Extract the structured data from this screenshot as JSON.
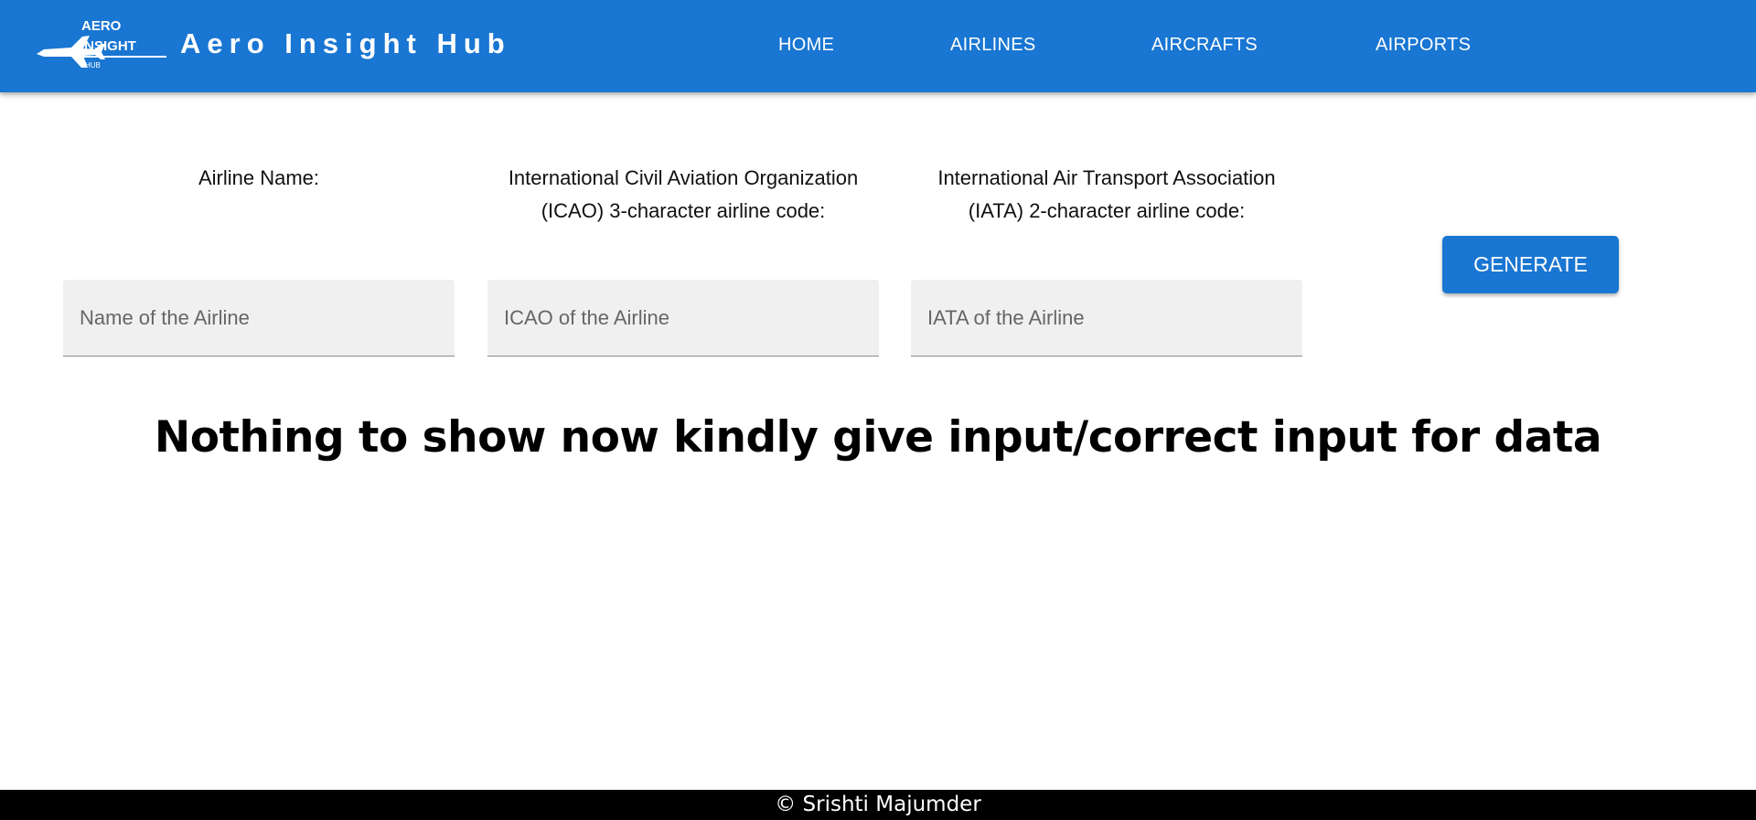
{
  "header": {
    "logo": {
      "word1": "AERO",
      "word2": "INSIGHT",
      "word3": "HUB"
    },
    "title": "Aero Insight Hub",
    "nav": [
      {
        "label": "HOME"
      },
      {
        "label": "AIRLINES"
      },
      {
        "label": "AIRCRAFTS"
      },
      {
        "label": "AIRPORTS"
      }
    ]
  },
  "form": {
    "name": {
      "label": "Airline Name:",
      "placeholder": "Name of the Airline",
      "value": ""
    },
    "icao": {
      "label": "International Civil Aviation Organization (ICAO) 3-character airline code:",
      "placeholder": "ICAO of the Airline",
      "value": ""
    },
    "iata": {
      "label": "International Air Transport Association (IATA) 2-character airline code:",
      "placeholder": "IATA of the Airline",
      "value": ""
    },
    "generate_label": "GENERATE"
  },
  "main": {
    "empty_message": "Nothing to show now kindly give input/correct input for data"
  },
  "footer": {
    "text": "© Srishti Majumder"
  },
  "colors": {
    "primary": "#1976d2",
    "footer_bg": "#000000",
    "input_bg": "#f0f0f0"
  }
}
